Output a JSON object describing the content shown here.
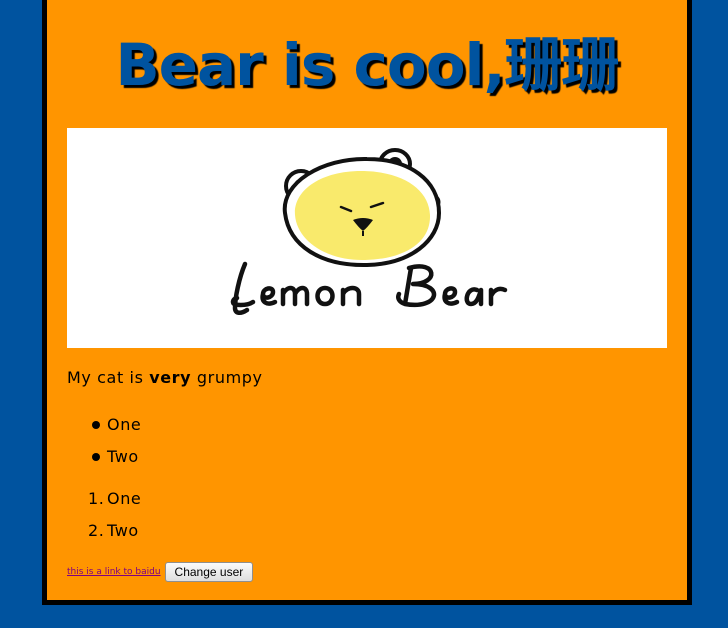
{
  "page": {
    "title": "Bear is cool,珊珊",
    "hero_image": {
      "alt": "Lemon Bear",
      "logo_text": "Lemon Bear"
    },
    "paragraph": {
      "before": "My cat is ",
      "emphasis": "very",
      "after": " grumpy"
    },
    "unordered_list": [
      "One",
      "Two"
    ],
    "ordered_list": [
      {
        "marker": "1.",
        "label": "One"
      },
      {
        "marker": "2.",
        "label": "Two"
      }
    ],
    "link": {
      "label": "this is a link to baidu"
    },
    "button": {
      "label": "Change user"
    }
  },
  "colors": {
    "background": "#00539f",
    "panel": "#ff9500",
    "panel_border": "#000000",
    "title_text": "#00539f",
    "bear_face": "#f9ea6c",
    "visited_link": "#800080"
  }
}
